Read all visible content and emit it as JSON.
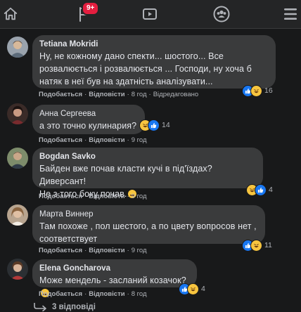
{
  "nav": {
    "notifications_badge": "9+"
  },
  "comments": [
    {
      "author": "Tetiana Mokridi",
      "lines": [
        "Ну, не кожному дано спекти... шостого... Все",
        "розвалюється і розвалюється ... Господи, ну хоча б",
        "натяк в неї був на здатність аналізувати..."
      ],
      "like_label": "Подобається",
      "reply_label": "Відповісти",
      "time": "8 год",
      "edited": "Відредаговано",
      "reaction_count": "16"
    },
    {
      "author": "Анна Сергеева",
      "lines": [
        "а это точно кулинария?"
      ],
      "like_label": "Подобається",
      "reply_label": "Відповісти",
      "time": "9 год",
      "reaction_count": "14"
    },
    {
      "author": "Bogdan Savko",
      "lines": [
        "Байден вже почав класти кучі в під'їздах?Диверсант!",
        "Не з того боку почав."
      ],
      "like_label": "Подобається",
      "reply_label": "Відповісти",
      "time": "9 год",
      "reaction_count": "4"
    },
    {
      "author": "Марта Виннер",
      "lines": [
        "Там похоже , пол шестого, а по цвету вопросов нет ,",
        "соответствует"
      ],
      "like_label": "Подобається",
      "reply_label": "Відповісти",
      "time": "9 год",
      "reaction_count": "11"
    },
    {
      "author": "Elena Goncharova",
      "lines": [
        "Може мендель - засланий козачок?"
      ],
      "like_label": "Подобається",
      "reply_label": "Відповісти",
      "time": "8 год",
      "reaction_count": "4"
    }
  ],
  "replies_link": "3 відповіді",
  "colors": {
    "background": "#18191a",
    "bubble": "#3a3b3c",
    "text": "#e4e6eb",
    "secondary_text": "#b0b3b8",
    "badge": "#e41e3f",
    "like": "#1877f2",
    "haha": "#f7c53f"
  }
}
